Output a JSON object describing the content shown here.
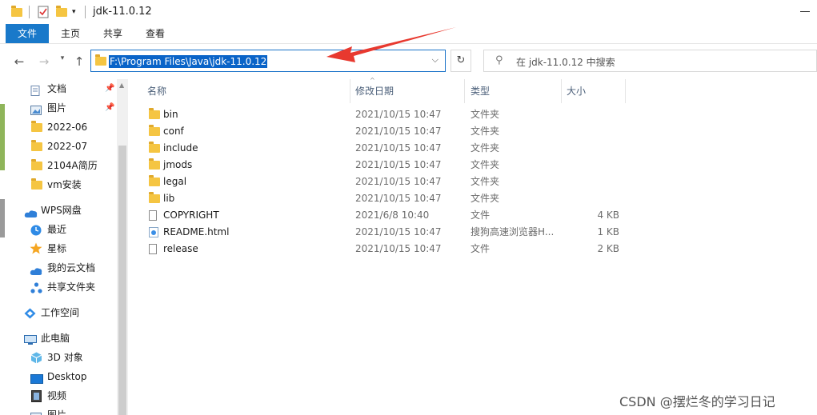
{
  "window": {
    "title": "jdk-11.0.12"
  },
  "ribbon": {
    "tabs": [
      "文件",
      "主页",
      "共享",
      "查看"
    ]
  },
  "address": {
    "path": "F:\\Program Files\\Java\\jdk-11.0.12"
  },
  "search": {
    "placeholder": "在 jdk-11.0.12 中搜索"
  },
  "sidebar": {
    "items": [
      {
        "label": "文档",
        "icon": "document-icon",
        "pinned": true
      },
      {
        "label": "图片",
        "icon": "pictures-icon",
        "pinned": true
      },
      {
        "label": "2022-06",
        "icon": "folder-icon"
      },
      {
        "label": "2022-07",
        "icon": "folder-icon"
      },
      {
        "label": "2104A简历",
        "icon": "folder-icon"
      },
      {
        "label": "vm安装",
        "icon": "folder-icon"
      },
      {
        "label": "WPS网盘",
        "icon": "cloud-icon"
      },
      {
        "label": "最近",
        "icon": "clock-icon"
      },
      {
        "label": "星标",
        "icon": "star-icon"
      },
      {
        "label": "我的云文档",
        "icon": "cloud-icon"
      },
      {
        "label": "共享文件夹",
        "icon": "share-icon"
      },
      {
        "label": "工作空间",
        "icon": "workspace-icon"
      },
      {
        "label": "此电脑",
        "icon": "computer-icon"
      },
      {
        "label": "3D 对象",
        "icon": "cube-icon"
      },
      {
        "label": "Desktop",
        "icon": "desktop-icon"
      },
      {
        "label": "视频",
        "icon": "video-icon"
      },
      {
        "label": "图片",
        "icon": "pictures-icon"
      }
    ]
  },
  "columns": {
    "name": "名称",
    "date": "修改日期",
    "type": "类型",
    "size": "大小"
  },
  "files": [
    {
      "name": "bin",
      "date": "2021/10/15 10:47",
      "type": "文件夹",
      "size": "",
      "icon": "folder-icon"
    },
    {
      "name": "conf",
      "date": "2021/10/15 10:47",
      "type": "文件夹",
      "size": "",
      "icon": "folder-icon"
    },
    {
      "name": "include",
      "date": "2021/10/15 10:47",
      "type": "文件夹",
      "size": "",
      "icon": "folder-icon"
    },
    {
      "name": "jmods",
      "date": "2021/10/15 10:47",
      "type": "文件夹",
      "size": "",
      "icon": "folder-icon"
    },
    {
      "name": "legal",
      "date": "2021/10/15 10:47",
      "type": "文件夹",
      "size": "",
      "icon": "folder-icon"
    },
    {
      "name": "lib",
      "date": "2021/10/15 10:47",
      "type": "文件夹",
      "size": "",
      "icon": "folder-icon"
    },
    {
      "name": "COPYRIGHT",
      "date": "2021/6/8 10:40",
      "type": "文件",
      "size": "4 KB",
      "icon": "file-icon"
    },
    {
      "name": "README.html",
      "date": "2021/10/15 10:47",
      "type": "搜狗高速浏览器H...",
      "size": "1 KB",
      "icon": "html-file-icon"
    },
    {
      "name": "release",
      "date": "2021/10/15 10:47",
      "type": "文件",
      "size": "2 KB",
      "icon": "file-icon"
    }
  ],
  "watermark": "CSDN @摆烂冬的学习日记",
  "colors": {
    "accent": "#1979ca",
    "selection": "#0a64c8",
    "folder": "#f5c542",
    "arrow": "#e8392f"
  }
}
